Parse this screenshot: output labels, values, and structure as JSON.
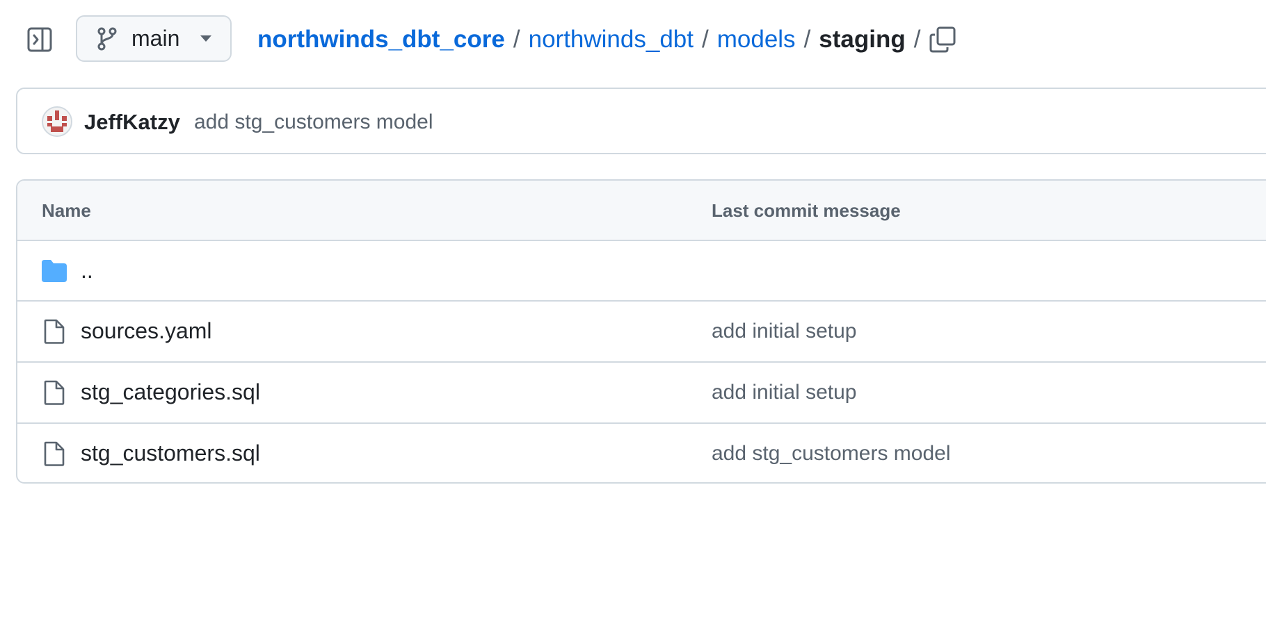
{
  "header": {
    "branch": "main",
    "breadcrumb": {
      "root": "northwinds_dbt_core",
      "parts": [
        "northwinds_dbt",
        "models"
      ],
      "current": "staging",
      "separator": "/"
    },
    "icons": {
      "sidebar_toggle": "sidebar-expand-icon",
      "branch": "git-branch-icon",
      "caret": "triangle-down-icon",
      "copy": "copy-icon"
    }
  },
  "latest_commit": {
    "author": "JeffKatzy",
    "message": "add stg_customers model"
  },
  "file_table": {
    "columns": {
      "name": "Name",
      "message": "Last commit message"
    },
    "parent_dir": "..",
    "files": [
      {
        "name": "sources.yaml",
        "message": "add initial setup",
        "icon": "file-icon"
      },
      {
        "name": "stg_categories.sql",
        "message": "add initial setup",
        "icon": "file-icon"
      },
      {
        "name": "stg_customers.sql",
        "message": "add stg_customers model",
        "icon": "file-icon"
      }
    ]
  },
  "colors": {
    "link": "#0969da",
    "folder": "#54aeff",
    "border": "#d1d9e0",
    "muted": "#59636e",
    "text": "#1f2328",
    "avatar_accent": "#c0504d"
  }
}
